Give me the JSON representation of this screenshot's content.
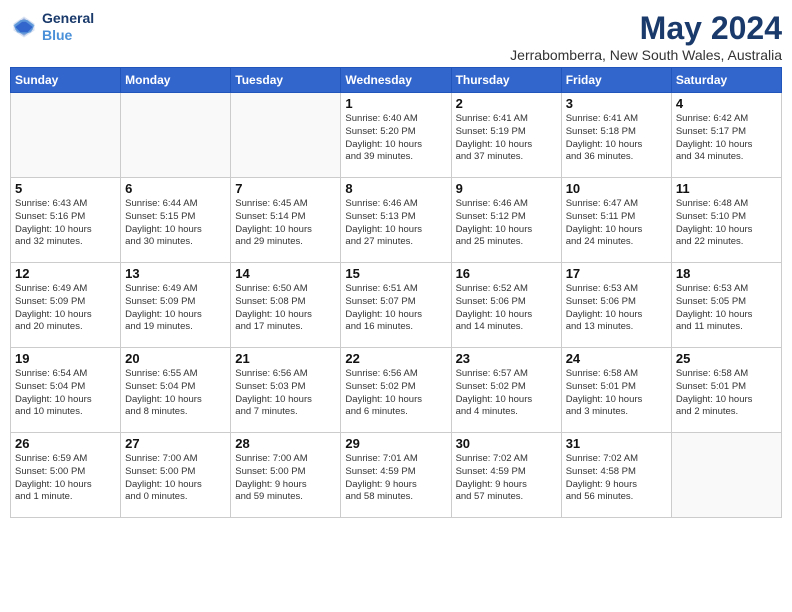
{
  "logo": {
    "line1": "General",
    "line2": "Blue"
  },
  "title": "May 2024",
  "subtitle": "Jerrabomberra, New South Wales, Australia",
  "days_of_week": [
    "Sunday",
    "Monday",
    "Tuesday",
    "Wednesday",
    "Thursday",
    "Friday",
    "Saturday"
  ],
  "weeks": [
    [
      {
        "day": "",
        "text": ""
      },
      {
        "day": "",
        "text": ""
      },
      {
        "day": "",
        "text": ""
      },
      {
        "day": "1",
        "text": "Sunrise: 6:40 AM\nSunset: 5:20 PM\nDaylight: 10 hours\nand 39 minutes."
      },
      {
        "day": "2",
        "text": "Sunrise: 6:41 AM\nSunset: 5:19 PM\nDaylight: 10 hours\nand 37 minutes."
      },
      {
        "day": "3",
        "text": "Sunrise: 6:41 AM\nSunset: 5:18 PM\nDaylight: 10 hours\nand 36 minutes."
      },
      {
        "day": "4",
        "text": "Sunrise: 6:42 AM\nSunset: 5:17 PM\nDaylight: 10 hours\nand 34 minutes."
      }
    ],
    [
      {
        "day": "5",
        "text": "Sunrise: 6:43 AM\nSunset: 5:16 PM\nDaylight: 10 hours\nand 32 minutes."
      },
      {
        "day": "6",
        "text": "Sunrise: 6:44 AM\nSunset: 5:15 PM\nDaylight: 10 hours\nand 30 minutes."
      },
      {
        "day": "7",
        "text": "Sunrise: 6:45 AM\nSunset: 5:14 PM\nDaylight: 10 hours\nand 29 minutes."
      },
      {
        "day": "8",
        "text": "Sunrise: 6:46 AM\nSunset: 5:13 PM\nDaylight: 10 hours\nand 27 minutes."
      },
      {
        "day": "9",
        "text": "Sunrise: 6:46 AM\nSunset: 5:12 PM\nDaylight: 10 hours\nand 25 minutes."
      },
      {
        "day": "10",
        "text": "Sunrise: 6:47 AM\nSunset: 5:11 PM\nDaylight: 10 hours\nand 24 minutes."
      },
      {
        "day": "11",
        "text": "Sunrise: 6:48 AM\nSunset: 5:10 PM\nDaylight: 10 hours\nand 22 minutes."
      }
    ],
    [
      {
        "day": "12",
        "text": "Sunrise: 6:49 AM\nSunset: 5:09 PM\nDaylight: 10 hours\nand 20 minutes."
      },
      {
        "day": "13",
        "text": "Sunrise: 6:49 AM\nSunset: 5:09 PM\nDaylight: 10 hours\nand 19 minutes."
      },
      {
        "day": "14",
        "text": "Sunrise: 6:50 AM\nSunset: 5:08 PM\nDaylight: 10 hours\nand 17 minutes."
      },
      {
        "day": "15",
        "text": "Sunrise: 6:51 AM\nSunset: 5:07 PM\nDaylight: 10 hours\nand 16 minutes."
      },
      {
        "day": "16",
        "text": "Sunrise: 6:52 AM\nSunset: 5:06 PM\nDaylight: 10 hours\nand 14 minutes."
      },
      {
        "day": "17",
        "text": "Sunrise: 6:53 AM\nSunset: 5:06 PM\nDaylight: 10 hours\nand 13 minutes."
      },
      {
        "day": "18",
        "text": "Sunrise: 6:53 AM\nSunset: 5:05 PM\nDaylight: 10 hours\nand 11 minutes."
      }
    ],
    [
      {
        "day": "19",
        "text": "Sunrise: 6:54 AM\nSunset: 5:04 PM\nDaylight: 10 hours\nand 10 minutes."
      },
      {
        "day": "20",
        "text": "Sunrise: 6:55 AM\nSunset: 5:04 PM\nDaylight: 10 hours\nand 8 minutes."
      },
      {
        "day": "21",
        "text": "Sunrise: 6:56 AM\nSunset: 5:03 PM\nDaylight: 10 hours\nand 7 minutes."
      },
      {
        "day": "22",
        "text": "Sunrise: 6:56 AM\nSunset: 5:02 PM\nDaylight: 10 hours\nand 6 minutes."
      },
      {
        "day": "23",
        "text": "Sunrise: 6:57 AM\nSunset: 5:02 PM\nDaylight: 10 hours\nand 4 minutes."
      },
      {
        "day": "24",
        "text": "Sunrise: 6:58 AM\nSunset: 5:01 PM\nDaylight: 10 hours\nand 3 minutes."
      },
      {
        "day": "25",
        "text": "Sunrise: 6:58 AM\nSunset: 5:01 PM\nDaylight: 10 hours\nand 2 minutes."
      }
    ],
    [
      {
        "day": "26",
        "text": "Sunrise: 6:59 AM\nSunset: 5:00 PM\nDaylight: 10 hours\nand 1 minute."
      },
      {
        "day": "27",
        "text": "Sunrise: 7:00 AM\nSunset: 5:00 PM\nDaylight: 10 hours\nand 0 minutes."
      },
      {
        "day": "28",
        "text": "Sunrise: 7:00 AM\nSunset: 5:00 PM\nDaylight: 9 hours\nand 59 minutes."
      },
      {
        "day": "29",
        "text": "Sunrise: 7:01 AM\nSunset: 4:59 PM\nDaylight: 9 hours\nand 58 minutes."
      },
      {
        "day": "30",
        "text": "Sunrise: 7:02 AM\nSunset: 4:59 PM\nDaylight: 9 hours\nand 57 minutes."
      },
      {
        "day": "31",
        "text": "Sunrise: 7:02 AM\nSunset: 4:58 PM\nDaylight: 9 hours\nand 56 minutes."
      },
      {
        "day": "",
        "text": ""
      }
    ]
  ]
}
